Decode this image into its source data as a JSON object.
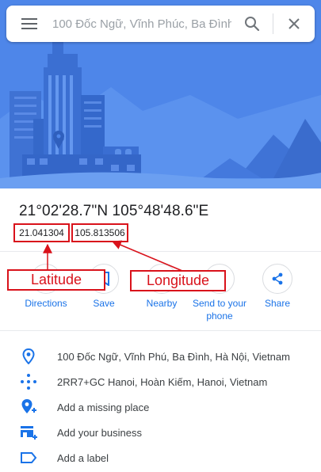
{
  "search": {
    "query": "100 Đốc Ngữ, Vĩnh Phúc, Ba Đình",
    "icons": [
      "menu-icon",
      "search-icon",
      "close-icon"
    ]
  },
  "place": {
    "title": "21°02'28.7\"N 105°48'48.6\"E",
    "latitude": "21.041304",
    "longitude": "105.813506"
  },
  "actions": [
    {
      "label": "Directions",
      "icon": "directions-icon"
    },
    {
      "label": "Save",
      "icon": "bookmark-icon"
    },
    {
      "label": "Nearby",
      "icon": "nearby-icon"
    },
    {
      "label": "Send to your phone",
      "icon": "phone-icon"
    },
    {
      "label": "Share",
      "icon": "share-icon"
    }
  ],
  "annotations": {
    "latitude_label": "Latitude",
    "longitude_label": "Longitude",
    "color": "#d9121b"
  },
  "info": [
    {
      "text": "100 Đốc Ngữ, Vĩnh Phú, Ba Đình, Hà Nội, Vietnam",
      "icon": "location-pin-icon"
    },
    {
      "text": "2RR7+GC Hanoi, Hoàn Kiếm, Hanoi, Vietnam",
      "icon": "plus-code-icon"
    },
    {
      "text": "Add a missing place",
      "icon": "add-place-icon"
    },
    {
      "text": "Add your business",
      "icon": "add-business-icon"
    },
    {
      "text": "Add a label",
      "icon": "label-icon"
    }
  ],
  "colors": {
    "accent": "#1a73e8",
    "hero_blue": "#4f85e8",
    "annotation_red": "#d9121b"
  }
}
